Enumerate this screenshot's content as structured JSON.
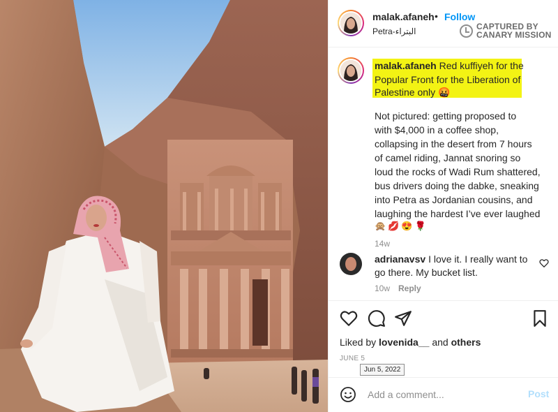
{
  "post": {
    "username": "malak.afaneh",
    "separator": "•",
    "follow_label": "Follow",
    "location": "Petra-البتراء"
  },
  "watermark": {
    "line1": "CAPTURED BY",
    "line2": "CANARY MISSION"
  },
  "caption": {
    "username": "malak.afaneh",
    "line1_text": "Red kuffiyeh for the",
    "line2": "Popular Front for the Liberation of",
    "line3_text": "Palestine only",
    "line3_emoji": "🤬",
    "body_lines": [
      "Not pictured: getting proposed to",
      "with $4,000 in a coffee shop,",
      "collapsing in the desert from 7 hours",
      "of camel riding, Jannat snoring so",
      "loud the rocks of Wadi Rum shattered,",
      "bus drivers doing the dabke, sneaking",
      "into Petra as Jordanian cousins, and",
      "laughing the hardest I’ve ever laughed"
    ],
    "emojis": "🙊💋😍🌹",
    "time": "14w"
  },
  "comment": {
    "username": "adrianavsv",
    "line1_text": "I love it. I really want to",
    "line2": "go there. My bucket list.",
    "time": "10w",
    "reply_label": "Reply"
  },
  "likes": {
    "prefix": "Liked by",
    "user": "lovenida__",
    "conjunction": "and",
    "others": "others"
  },
  "date": {
    "label": "JUNE 5",
    "tooltip": "Jun 5, 2022"
  },
  "add_comment": {
    "placeholder": "Add a comment...",
    "post_label": "Post"
  },
  "colors": {
    "follow_blue": "#0095f6",
    "highlight_yellow": "#f3f314",
    "post_disabled": "#b2dffc"
  },
  "icons": {
    "like": "heart-icon",
    "comment": "comment-icon",
    "share": "send-icon",
    "save": "bookmark-icon",
    "emoji": "smiley-icon",
    "comment_like": "heart-icon"
  }
}
